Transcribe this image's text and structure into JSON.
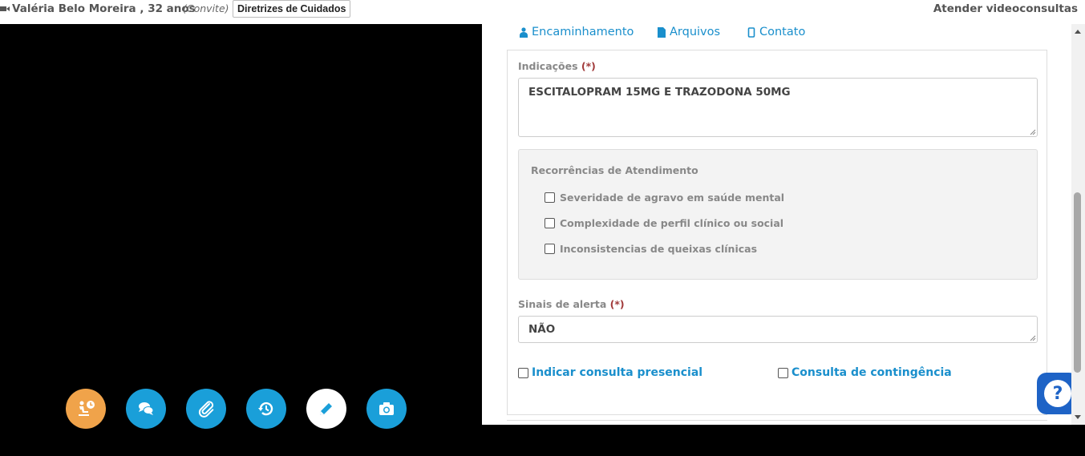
{
  "header": {
    "patient_name": "Valéria Belo Moreira , 32 anos",
    "invite_label": "(Convite)",
    "guidelines_button": "Diretrizes de Cuidados",
    "attend_label": "Atender videoconsultas"
  },
  "tabs": {
    "referral": "Encaminhamento",
    "files": "Arquivos",
    "contact": "Contato"
  },
  "form": {
    "indications_label": "Indicações",
    "indications_required": "(*)",
    "indications_value": "ESCITALOPRAM 15MG E TRAZODONA 50MG",
    "recurrence_title": "Recorrências de Atendimento",
    "recurrence_options": [
      "Severidade de agravo em saúde mental",
      "Complexidade de perfil clínico ou social",
      "Inconsistencias de queixas clínicas"
    ],
    "alert_label": "Sinais de alerta",
    "alert_required": "(*)",
    "alert_value": "NÃO",
    "in_person_label": "Indicar consulta presencial",
    "contingency_label": "Consulta de contingência"
  },
  "help": {
    "symbol": "?"
  },
  "icons": {
    "wait": "patient-waiting-icon",
    "chat": "chat-icon",
    "attach": "paperclip-icon",
    "history": "history-icon",
    "edit": "pencil-icon",
    "camera": "camera-icon"
  },
  "colors": {
    "accent_blue": "#1a9fd9",
    "link_blue": "#1a8fcc",
    "orange": "#f0a34a",
    "required_red": "#a13a3a",
    "help_blue": "#1e63c6"
  }
}
